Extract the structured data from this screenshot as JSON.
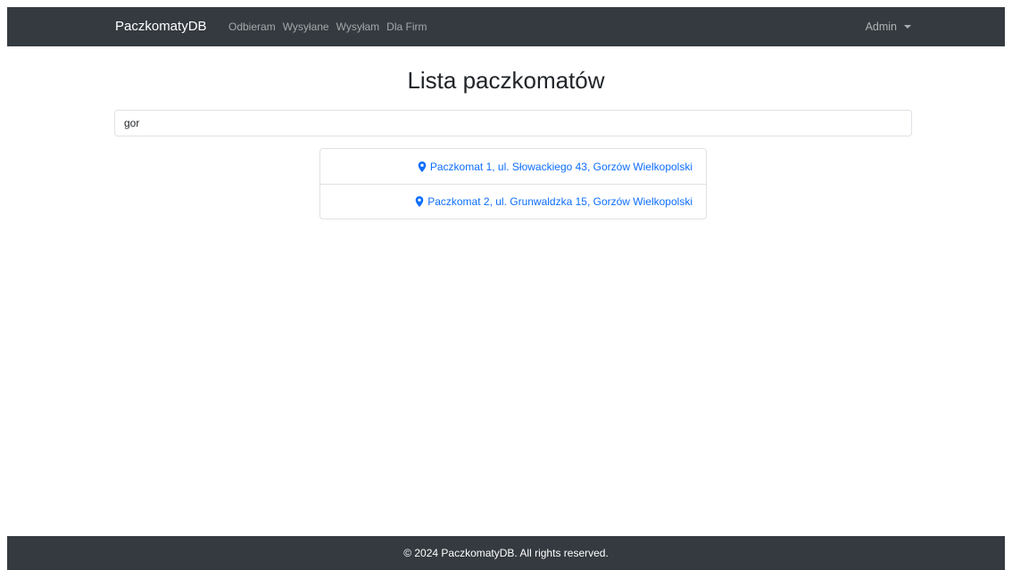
{
  "navbar": {
    "brand": "PaczkomatyDB",
    "links": [
      "Odbieram",
      "Wysyłane",
      "Wysyłam",
      "Dla Firm"
    ],
    "user": "Admin"
  },
  "main": {
    "title": "Lista paczkomatów",
    "search": {
      "value": "gor"
    },
    "results": [
      "Paczkomat 1, ul. Słowackiego 43, Gorzów Wielkopolski",
      "Paczkomat 2, ul. Grunwaldzka 15, Gorzów Wielkopolski"
    ]
  },
  "footer": {
    "text": "© 2024 PaczkomatyDB. All rights reserved."
  },
  "icons": {
    "result_icon": "map-marker-icon",
    "user_menu_icon": "caret-down-icon"
  },
  "colors": {
    "navbar_bg": "#343a40",
    "link": "#0d6efd"
  }
}
